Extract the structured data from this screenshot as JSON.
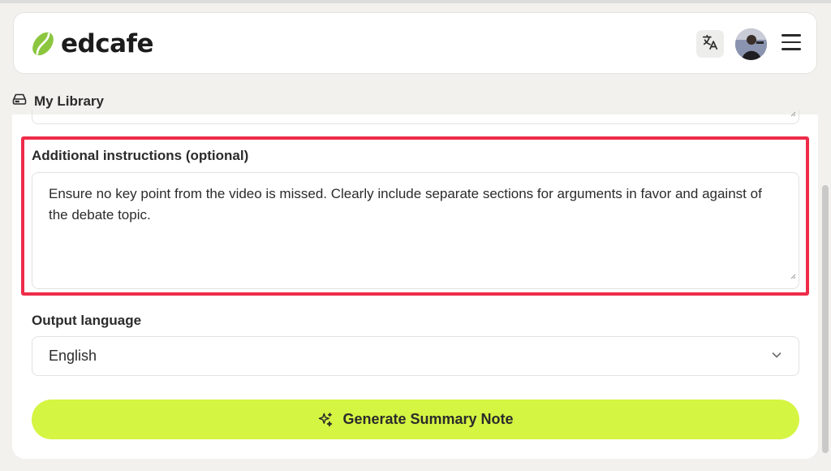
{
  "header": {
    "logo_text": "edcafe",
    "brand_color": "#8cc63f",
    "icons": [
      "leaf-logo-icon",
      "translate-icon",
      "avatar",
      "hamburger-menu-icon"
    ]
  },
  "nav": {
    "library_label": "My Library",
    "library_icon": "drive-icon"
  },
  "form": {
    "instructions_label": "Additional instructions (optional)",
    "instructions_value": "Ensure no key point from the video is missed. Clearly include separate sections for arguments in favor and against of the debate topic.",
    "output_language_label": "Output language",
    "output_language_value": "English",
    "generate_label": "Generate Summary Note",
    "generate_color": "#d4f542",
    "highlight_color": "#ee2c49"
  }
}
